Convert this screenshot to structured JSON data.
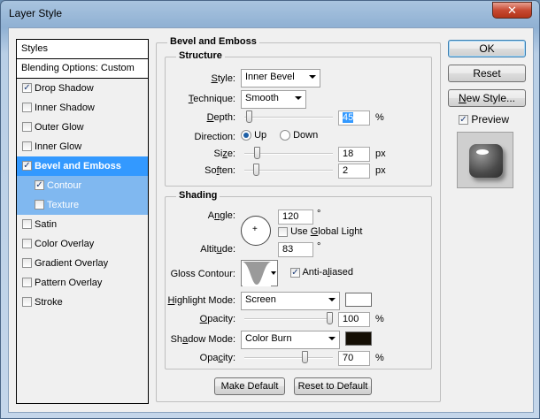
{
  "window": {
    "title": "Layer Style",
    "close_glyph": "✕"
  },
  "styles_panel": {
    "header": "Styles",
    "blending": "Blending Options: Custom",
    "items": [
      {
        "label": "Drop Shadow",
        "checked": true
      },
      {
        "label": "Inner Shadow",
        "checked": false
      },
      {
        "label": "Outer Glow",
        "checked": false
      },
      {
        "label": "Inner Glow",
        "checked": false
      },
      {
        "label": "Bevel and Emboss",
        "checked": true,
        "selected": true
      },
      {
        "label": "Contour",
        "checked": true,
        "sub": true
      },
      {
        "label": "Texture",
        "checked": false,
        "sub": true
      },
      {
        "label": "Satin",
        "checked": false
      },
      {
        "label": "Color Overlay",
        "checked": false
      },
      {
        "label": "Gradient Overlay",
        "checked": false
      },
      {
        "label": "Pattern Overlay",
        "checked": false
      },
      {
        "label": "Stroke",
        "checked": false
      }
    ]
  },
  "buttons": {
    "ok": "OK",
    "reset": "Reset",
    "new_style": "New Style...",
    "preview": "Preview",
    "preview_checked": true
  },
  "bevel": {
    "section_title": "Bevel and Emboss",
    "structure": {
      "title": "Structure",
      "style_label": "Style:",
      "style_value": "Inner Bevel",
      "technique_label": "Technique:",
      "technique_value": "Smooth",
      "depth_label": "Depth:",
      "depth_value": "45",
      "depth_unit": "%",
      "depth_level": 0.02,
      "direction_label": "Direction:",
      "direction_up": "Up",
      "direction_down": "Down",
      "direction_selected": "Up",
      "size_label": "Size:",
      "size_value": "18",
      "size_unit": "px",
      "size_level": 0.12,
      "soften_label": "Soften:",
      "soften_value": "2",
      "soften_unit": "px",
      "soften_level": 0.11
    },
    "shading": {
      "title": "Shading",
      "angle_label": "Angle:",
      "angle_value": "120",
      "angle_unit": "°",
      "global_light_label": "Use Global Light",
      "global_light_checked": false,
      "altitude_label": "Altitude:",
      "altitude_value": "83",
      "altitude_unit": "°",
      "gloss_label": "Gloss Contour:",
      "antialiased_label": "Anti-aliased",
      "antialiased_checked": true,
      "highlight_mode_label": "Highlight Mode:",
      "highlight_mode_value": "Screen",
      "highlight_color": "#ffffff",
      "highlight_opacity_label": "Opacity:",
      "highlight_opacity_value": "100",
      "highlight_opacity_unit": "%",
      "highlight_opacity_level": 1.0,
      "shadow_mode_label": "Shadow Mode:",
      "shadow_mode_value": "Color Burn",
      "shadow_color": "#140e04",
      "shadow_opacity_label": "Opacity:",
      "shadow_opacity_value": "70",
      "shadow_opacity_unit": "%",
      "shadow_opacity_level": 0.7
    },
    "make_default": "Make Default",
    "reset_default": "Reset to Default"
  }
}
